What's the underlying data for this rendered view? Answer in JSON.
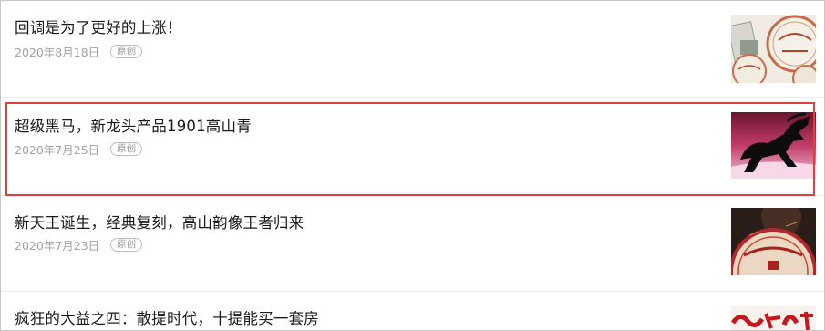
{
  "articles": [
    {
      "title": "回调是为了更好的上涨！",
      "date": "2020年8月18日",
      "badge": "原创",
      "thumbnail_icon": "tea-cake-photo"
    },
    {
      "title": "超级黑马，新龙头产品1901高山青",
      "date": "2020年7月25日",
      "badge": "原创",
      "thumbnail_icon": "black-horse-photo"
    },
    {
      "title": "新天王诞生，经典复刻，高山韵像王者归来",
      "date": "2020年7月23日",
      "badge": "原创",
      "thumbnail_icon": "tea-wrapper-photo"
    },
    {
      "title": "疯狂的大益之四：散提时代，十提能买一套房",
      "thumbnail_icon": "red-calligraphy-photo"
    }
  ],
  "colors": {
    "highlight": "#e0403a",
    "title": "#1a1a1a",
    "meta": "#a3a3a3"
  }
}
